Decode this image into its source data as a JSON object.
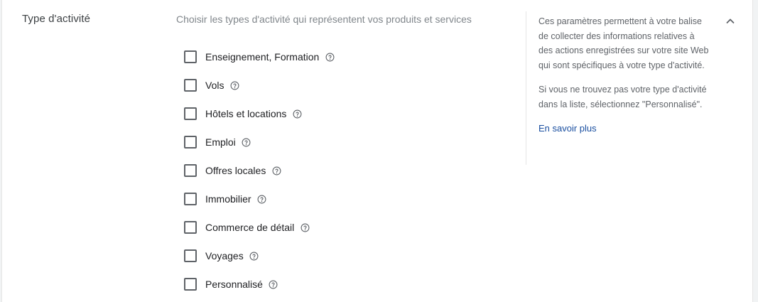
{
  "section": {
    "title": "Type d'activité",
    "subtitle": "Choisir les types d'activité qui représentent vos produits et services"
  },
  "options": [
    {
      "label": "Enseignement, Formation",
      "checked": false,
      "icon": "help-circle-icon"
    },
    {
      "label": "Vols",
      "checked": false,
      "icon": "help-circle-icon"
    },
    {
      "label": "Hôtels et locations",
      "checked": false,
      "icon": "help-circle-icon"
    },
    {
      "label": "Emploi",
      "checked": false,
      "icon": "help-circle-icon"
    },
    {
      "label": "Offres locales",
      "checked": false,
      "icon": "help-circle-icon"
    },
    {
      "label": "Immobilier",
      "checked": false,
      "icon": "help-circle-icon"
    },
    {
      "label": "Commerce de détail",
      "checked": false,
      "icon": "help-circle-icon"
    },
    {
      "label": "Voyages",
      "checked": false,
      "icon": "help-circle-icon"
    },
    {
      "label": "Personnalisé",
      "checked": false,
      "icon": "help-circle-icon"
    }
  ],
  "aside": {
    "paragraph1": "Ces paramètres permettent à votre balise de collecter des informations relatives à des actions enregistrées sur votre site Web qui sont spécifiques à votre type d'activité.",
    "paragraph2": "Si vous ne trouvez pas votre type d'activité dans la liste, sélectionnez \"Personnalisé\".",
    "learn_more": "En savoir plus"
  },
  "collapse_icon": "chevron-up-icon",
  "colors": {
    "link": "#1a4fa0",
    "checkbox_border": "#5f6368",
    "muted_text": "#80868b",
    "background": "#f1f3f4"
  }
}
